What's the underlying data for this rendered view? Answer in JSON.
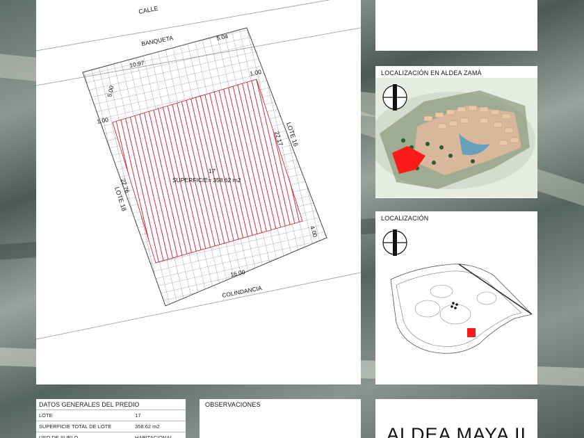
{
  "plan": {
    "street": "CALLE",
    "sidewalk": "BANQUETA",
    "neighbor_right": "LOTE 16",
    "neighbor_left": "LOTE 18",
    "rear": "COLINDANCIA",
    "lot_number": "17",
    "area_label": "SUPERFICIE= 358.62 m2",
    "dimensions": {
      "top_left": "10.97",
      "top_right": "5.04",
      "corner_right": "1.00",
      "setback_top": "5.00",
      "setback_left": "1.00",
      "side_right": "22.17",
      "side_left": "22.76",
      "bottom_right": "4.00",
      "bottom": "16.00"
    }
  },
  "location_aldea": {
    "title": "LOCALIZACIÓN EN ALDEA ZAMÁ"
  },
  "location": {
    "title": "LOCALIZACIÓN"
  },
  "general_data": {
    "title": "DATOS GENERALES DEL PREDIO",
    "rows": [
      {
        "label": "LOTE",
        "value": "17"
      },
      {
        "label": "SUPERFICIE TOTAL DE LOTE",
        "value": "358.62 m2"
      },
      {
        "label": "USO DE SUELO",
        "value": "HABITACIONAL"
      }
    ]
  },
  "observations": {
    "title": "OBSERVACIONES"
  },
  "brand": {
    "name": "ALDEA MAYA II"
  },
  "colors": {
    "highlight": "#ff1a1a",
    "hatch": "#c21a2a",
    "grid": "#555555"
  }
}
